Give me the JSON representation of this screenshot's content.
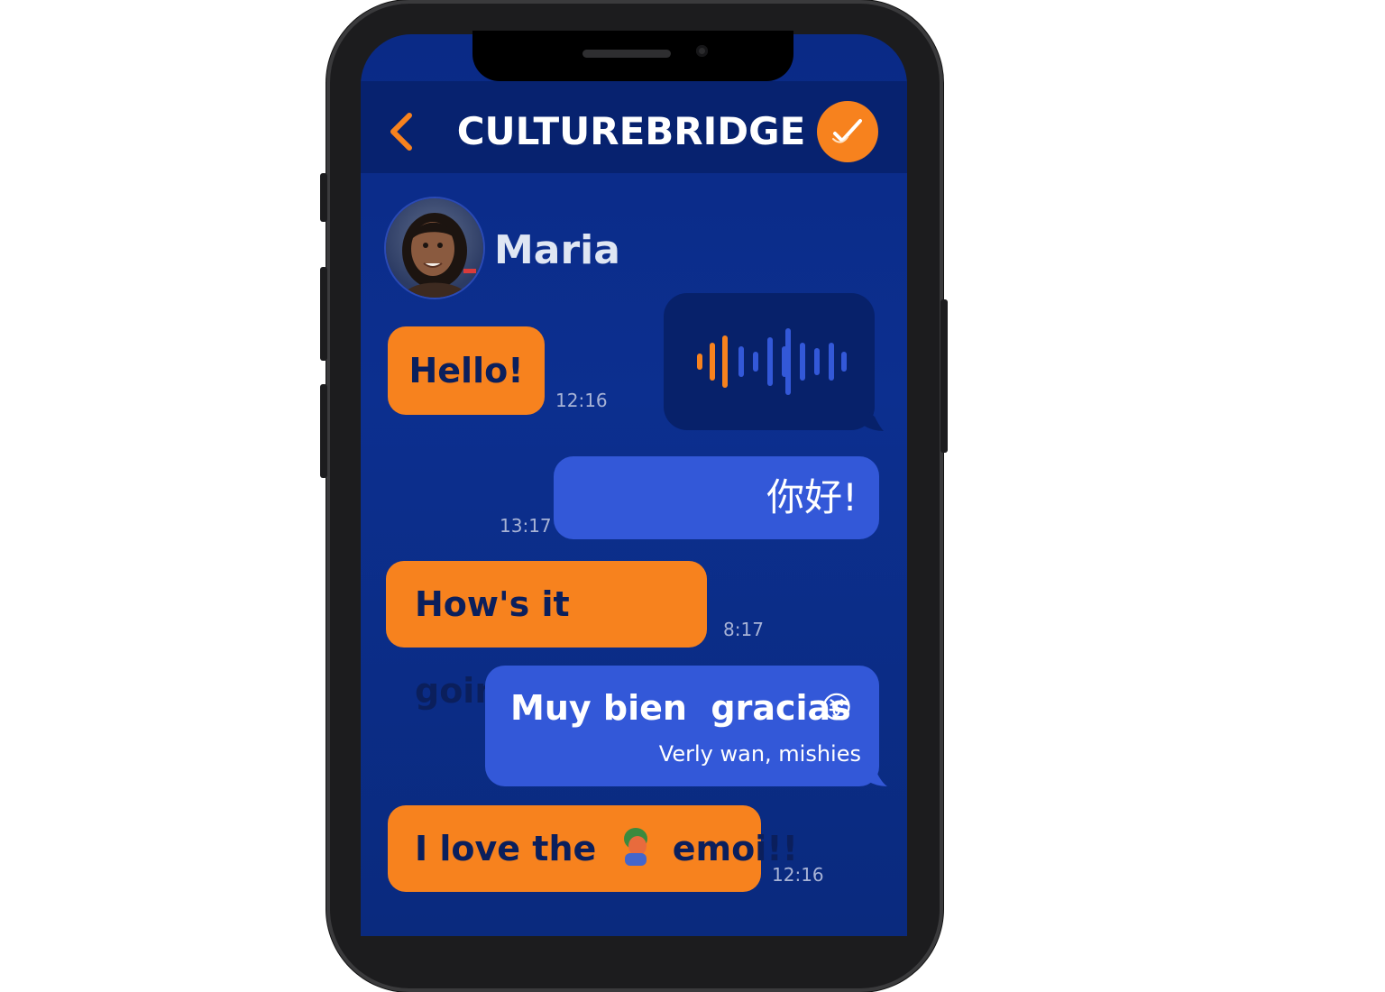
{
  "header": {
    "title": "CULTUREBRIDGE",
    "back_icon": "chevron-left-icon",
    "action_icon": "checkmark-icon"
  },
  "contact": {
    "name": "Maria"
  },
  "colors": {
    "accent": "#f7821e",
    "background": "#0a2a86",
    "outgoing_bubble": "#3358d8",
    "incoming_text": "#0b1f5c"
  },
  "messages": [
    {
      "direction": "incoming",
      "text": "Hello!",
      "time": "12:16"
    },
    {
      "direction": "outgoing",
      "type": "voice",
      "icon": "waveform-icon"
    },
    {
      "direction": "outgoing",
      "text": "你好!",
      "time": "13:17"
    },
    {
      "direction": "incoming",
      "text": "How's it going?",
      "time": "8:17"
    },
    {
      "direction": "outgoing",
      "text": "Muy bien  gracias",
      "translation": "Verly wan,  mishies",
      "emoji": "😝"
    },
    {
      "direction": "incoming",
      "text_before": "I love the",
      "emoji": "person-emoji-icon",
      "text_after": "emoi!!",
      "time": "12:16"
    }
  ]
}
